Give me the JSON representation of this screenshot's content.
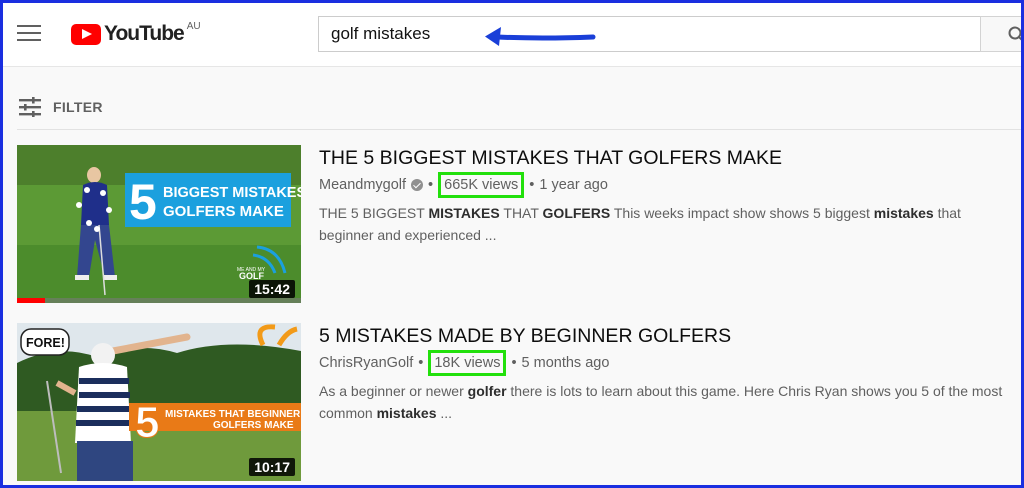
{
  "header": {
    "logo_text": "YouTube",
    "region": "AU",
    "search_value": "golf mistakes"
  },
  "filter": {
    "label": "FILTER"
  },
  "results": [
    {
      "title": "THE 5 BIGGEST MISTAKES THAT GOLFERS MAKE",
      "channel": "Meandmygolf",
      "verified": true,
      "views": "665K views",
      "age": "1 year ago",
      "description_parts": [
        {
          "t": "THE 5 BIGGEST ",
          "b": false
        },
        {
          "t": "MISTAKES",
          "b": true
        },
        {
          "t": " THAT ",
          "b": false
        },
        {
          "t": "GOLFERS",
          "b": true
        },
        {
          "t": " This weeks impact show shows 5 biggest ",
          "b": false
        },
        {
          "t": "mistakes",
          "b": true
        },
        {
          "t": " that beginner and experienced ...",
          "b": false
        }
      ],
      "duration": "15:42",
      "watch_progress": 0.1,
      "thumbnail": {
        "big_number": "5",
        "banner_line1": "BIGGEST MISTAKES",
        "banner_line2": "GOLFERS MAKE",
        "logo_line1": "ME AND MY",
        "logo_line2": "GOLF"
      }
    },
    {
      "title": "5 MISTAKES MADE BY BEGINNER GOLFERS",
      "channel": "ChrisRyanGolf",
      "verified": false,
      "views": "18K views",
      "age": "5 months ago",
      "description_parts": [
        {
          "t": "As a beginner or newer ",
          "b": false
        },
        {
          "t": "golfer",
          "b": true
        },
        {
          "t": " there is lots to learn about this game. Here Chris Ryan shows you 5 of the most common ",
          "b": false
        },
        {
          "t": "mistakes",
          "b": true
        },
        {
          "t": " ...",
          "b": false
        }
      ],
      "duration": "10:17",
      "thumbnail": {
        "bubble": "FORE!",
        "big_number": "5",
        "banner_line1": "MISTAKES THAT BEGINNER",
        "banner_line2": "GOLFERS MAKE"
      }
    }
  ],
  "colors": {
    "frame": "#1a2fe0",
    "highlight": "#22e00c",
    "arrow": "#1a3fd8",
    "brand_red": "#ff0000"
  }
}
